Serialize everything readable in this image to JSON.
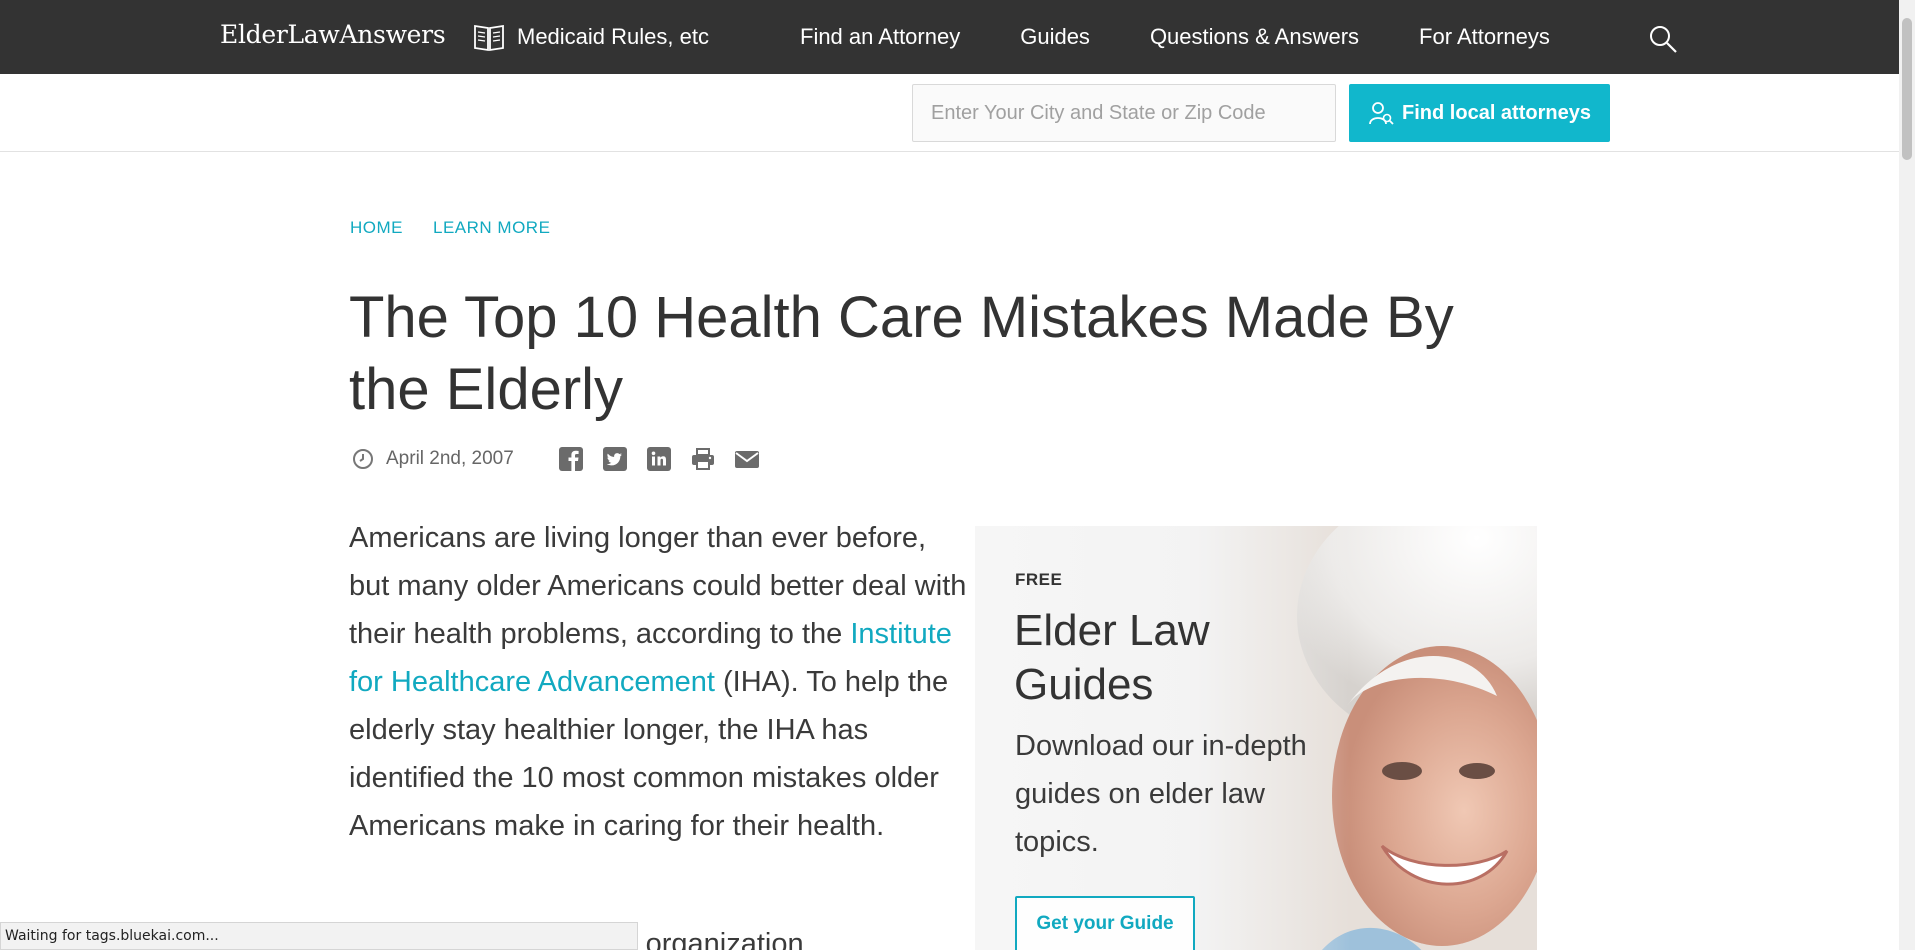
{
  "nav": {
    "brand": "ElderLawAnswers",
    "medicaid_label": "Medicaid Rules, etc",
    "links": [
      "Find an Attorney",
      "Guides",
      "Questions & Answers",
      "For Attorneys"
    ]
  },
  "search": {
    "placeholder": "Enter Your City and State or Zip Code",
    "button_label": "Find local attorneys"
  },
  "breadcrumb": [
    "HOME",
    "LEARN MORE"
  ],
  "article": {
    "title": "The Top 10 Health Care Mistakes Made By the Elderly",
    "date": "April 2nd, 2007",
    "share_icons": [
      "facebook-icon",
      "twitter-icon",
      "linkedin-icon",
      "print-icon",
      "email-icon"
    ],
    "intro_before_link": "Americans are living longer than ever before, but many older Americans could better deal with their health problems, according to the ",
    "link_text": "Institute for Healthcare Advancement",
    "intro_after_link": " (IHA). To help the elderly stay healthier longer, the IHA has identified the 10 most common mistakes older Americans make in caring for their health.",
    "next_line_fragment": "profit organization"
  },
  "promo": {
    "tag": "FREE",
    "heading": "Elder Law Guides",
    "text": "Download our in-depth guides on elder law topics.",
    "button_label": "Get your Guide"
  },
  "status": "Waiting for tags.bluekai.com...",
  "colors": {
    "nav_bg": "#333333",
    "accent": "#11b7cc",
    "link": "#11a9c0"
  }
}
